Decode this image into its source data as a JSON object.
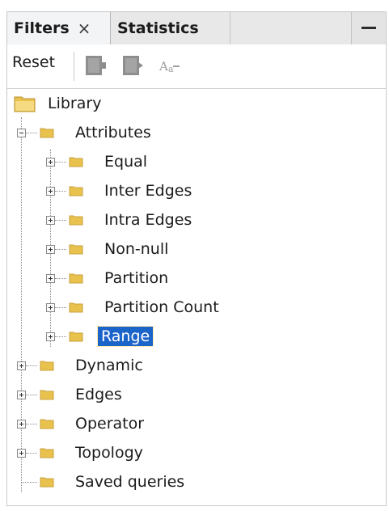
{
  "tabs": {
    "filters_label": "Filters",
    "close_symbol": "×",
    "statistics_label": "Statistics"
  },
  "toolbar": {
    "reset_label": "Reset"
  },
  "tree": {
    "root": "Library",
    "attributes": "Attributes",
    "attribute_children": [
      "Equal",
      "Inter Edges",
      "Intra Edges",
      "Non-null",
      "Partition",
      "Partition Count",
      "Range"
    ],
    "top_level": [
      "Dynamic",
      "Edges",
      "Operator",
      "Topology",
      "Saved queries"
    ],
    "selected": "Range"
  },
  "colors": {
    "selection": "#1b64c9",
    "folder": "#e9c24e",
    "disabled_icon": "#9e9e9e"
  },
  "icons": {
    "close": "close-icon",
    "minimize": "minimize-icon",
    "filter_add": "filter-add-icon",
    "filter_remove": "filter-remove-icon",
    "rename": "rename-icon",
    "folder": "folder-icon"
  }
}
